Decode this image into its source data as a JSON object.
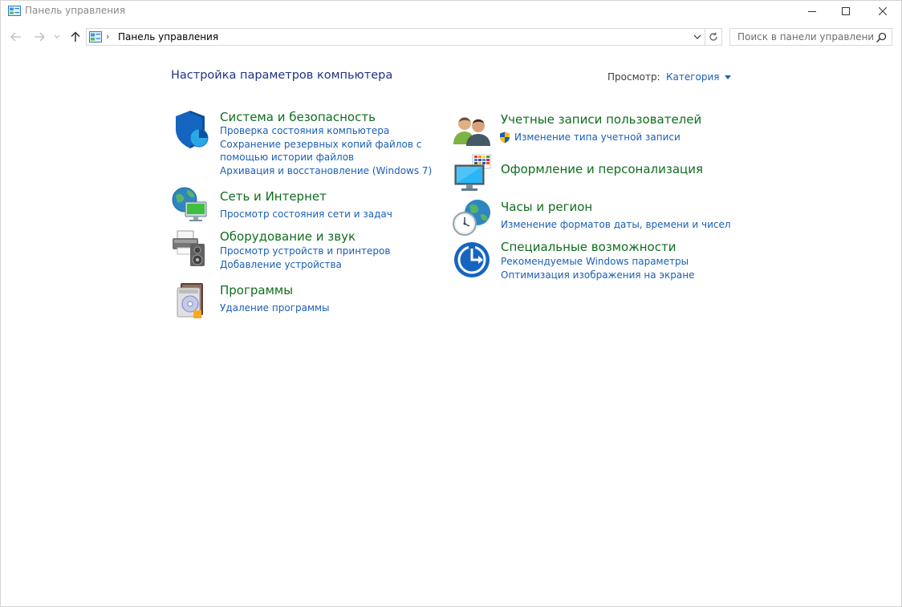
{
  "window": {
    "title": "Панель управления"
  },
  "address": {
    "path": "Панель управления"
  },
  "search": {
    "placeholder": "Поиск в панели управления"
  },
  "main": {
    "heading": "Настройка параметров компьютера",
    "view_by_label": "Просмотр:",
    "view_by_value": "Категория"
  },
  "categories": [
    {
      "title": "Система и безопасность",
      "icon": "shield-icon",
      "links": [
        "Проверка состояния компьютера",
        "Сохранение резервных копий файлов с помощью истории файлов",
        "Архивация и восстановление (Windows 7)"
      ]
    },
    {
      "title": "Сеть и Интернет",
      "icon": "network-globe-icon",
      "links": [
        "Просмотр состояния сети и задач"
      ]
    },
    {
      "title": "Оборудование и звук",
      "icon": "printer-speaker-icon",
      "links": [
        "Просмотр устройств и принтеров",
        "Добавление устройства"
      ]
    },
    {
      "title": "Программы",
      "icon": "programs-disc-icon",
      "links": [
        "Удаление программы"
      ]
    },
    {
      "title": "Учетные записи пользователей",
      "icon": "users-icon",
      "links": [
        "Изменение типа учетной записи"
      ]
    },
    {
      "title": "Оформление и персонализация",
      "icon": "monitor-palette-icon",
      "links": []
    },
    {
      "title": "Часы и регион",
      "icon": "clock-globe-icon",
      "links": [
        "Изменение форматов даты, времени и чисел"
      ]
    },
    {
      "title": "Специальные возможности",
      "icon": "ease-of-access-icon",
      "links": [
        "Рекомендуемые Windows параметры",
        "Оптимизация изображения на экране"
      ]
    }
  ],
  "colors": {
    "category_title": "#0f6e1e",
    "link": "#1a5fb4",
    "heading": "#1e3287"
  }
}
